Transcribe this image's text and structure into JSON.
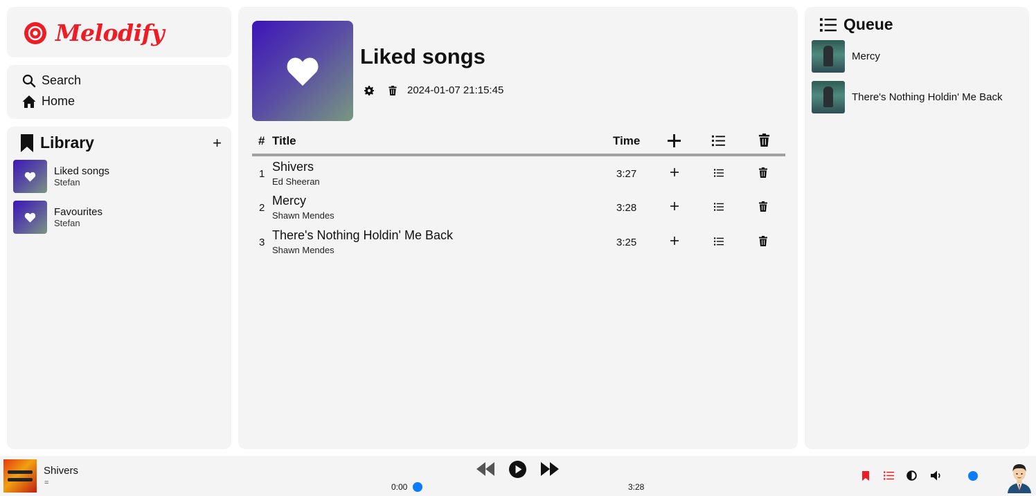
{
  "app": {
    "name": "Melodify",
    "brand_color": "#ee1c25",
    "accent_color": "#0a7cff"
  },
  "nav": {
    "search_label": "Search",
    "home_label": "Home"
  },
  "library": {
    "title": "Library",
    "add_label": "+",
    "items": [
      {
        "name": "Liked songs",
        "owner": "Stefan"
      },
      {
        "name": "Favourites",
        "owner": "Stefan"
      }
    ]
  },
  "playlist": {
    "title": "Liked songs",
    "created": "2024-01-07 21:15:45",
    "columns": {
      "num": "#",
      "title": "Title",
      "time": "Time"
    },
    "songs": [
      {
        "num": "1",
        "title": "Shivers",
        "artist": "Ed Sheeran",
        "time": "3:27"
      },
      {
        "num": "2",
        "title": "Mercy",
        "artist": "Shawn Mendes",
        "time": "3:28"
      },
      {
        "num": "3",
        "title": "There's Nothing Holdin' Me Back",
        "artist": "Shawn Mendes",
        "time": "3:25"
      }
    ]
  },
  "queue": {
    "title": "Queue",
    "items": [
      {
        "name": "Mercy"
      },
      {
        "name": "There's Nothing Holdin' Me Back"
      }
    ]
  },
  "player": {
    "title": "Shivers",
    "subtitle": "=",
    "current_time": "0:00",
    "duration": "3:28",
    "progress": 0,
    "volume": 1
  },
  "icons": {
    "logo": "vinyl-record-icon",
    "search": "search-icon",
    "home": "home-icon",
    "library": "bookmark-icon",
    "playlist_cover": "heart-icon",
    "settings": "gear-icon",
    "delete": "trash-icon",
    "queue": "list-icon",
    "add": "plus-icon",
    "previous": "rewind-icon",
    "play": "play-icon",
    "next": "fast-forward-icon",
    "theme": "contrast-icon",
    "volume": "volume-icon",
    "user": "avatar"
  }
}
